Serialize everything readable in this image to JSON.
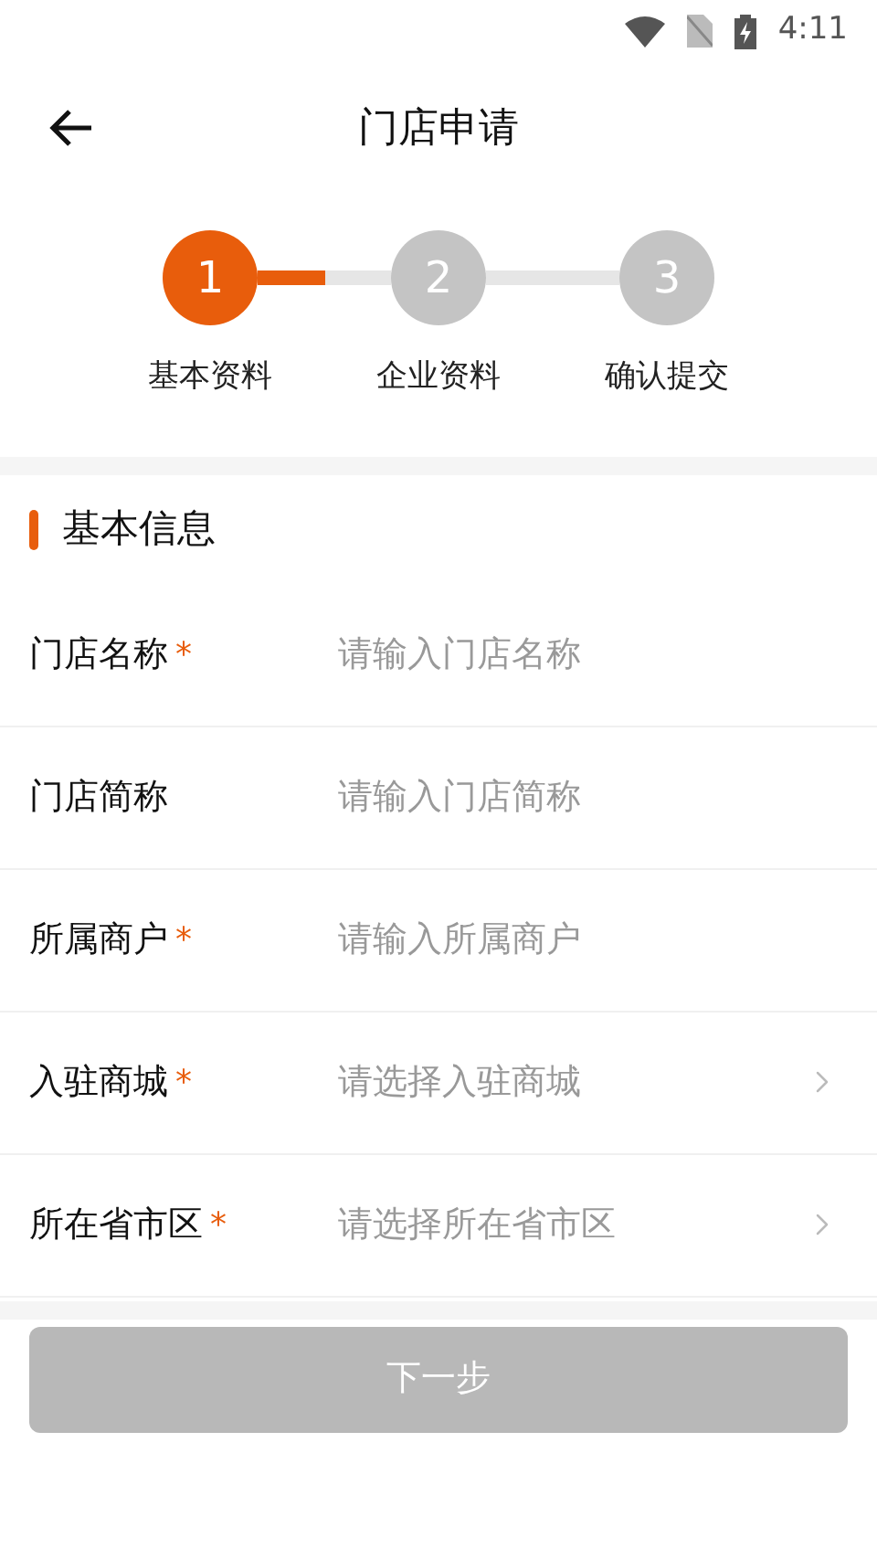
{
  "status_bar": {
    "time": "4:11"
  },
  "header": {
    "title": "门店申请"
  },
  "steps": [
    {
      "number": "1",
      "label": "基本资料",
      "active": true
    },
    {
      "number": "2",
      "label": "企业资料",
      "active": false
    },
    {
      "number": "3",
      "label": "确认提交",
      "active": false
    }
  ],
  "section": {
    "title": "基本信息"
  },
  "fields": [
    {
      "kind": "input",
      "label": "门店名称",
      "required_mark": "*",
      "placeholder": "请输入门店名称"
    },
    {
      "kind": "input",
      "label": "门店简称",
      "placeholder": "请输入门店简称"
    },
    {
      "kind": "input",
      "label": "所属商户",
      "required_mark": "*",
      "placeholder": "请输入所属商户"
    },
    {
      "kind": "select",
      "label": "入驻商城",
      "required_mark": "*",
      "placeholder": "请选择入驻商城"
    },
    {
      "kind": "select",
      "label": "所在省市区",
      "required_mark": "*",
      "placeholder": "请选择所在省市区"
    }
  ],
  "next_button": {
    "label": "下一步",
    "disabled": true
  }
}
